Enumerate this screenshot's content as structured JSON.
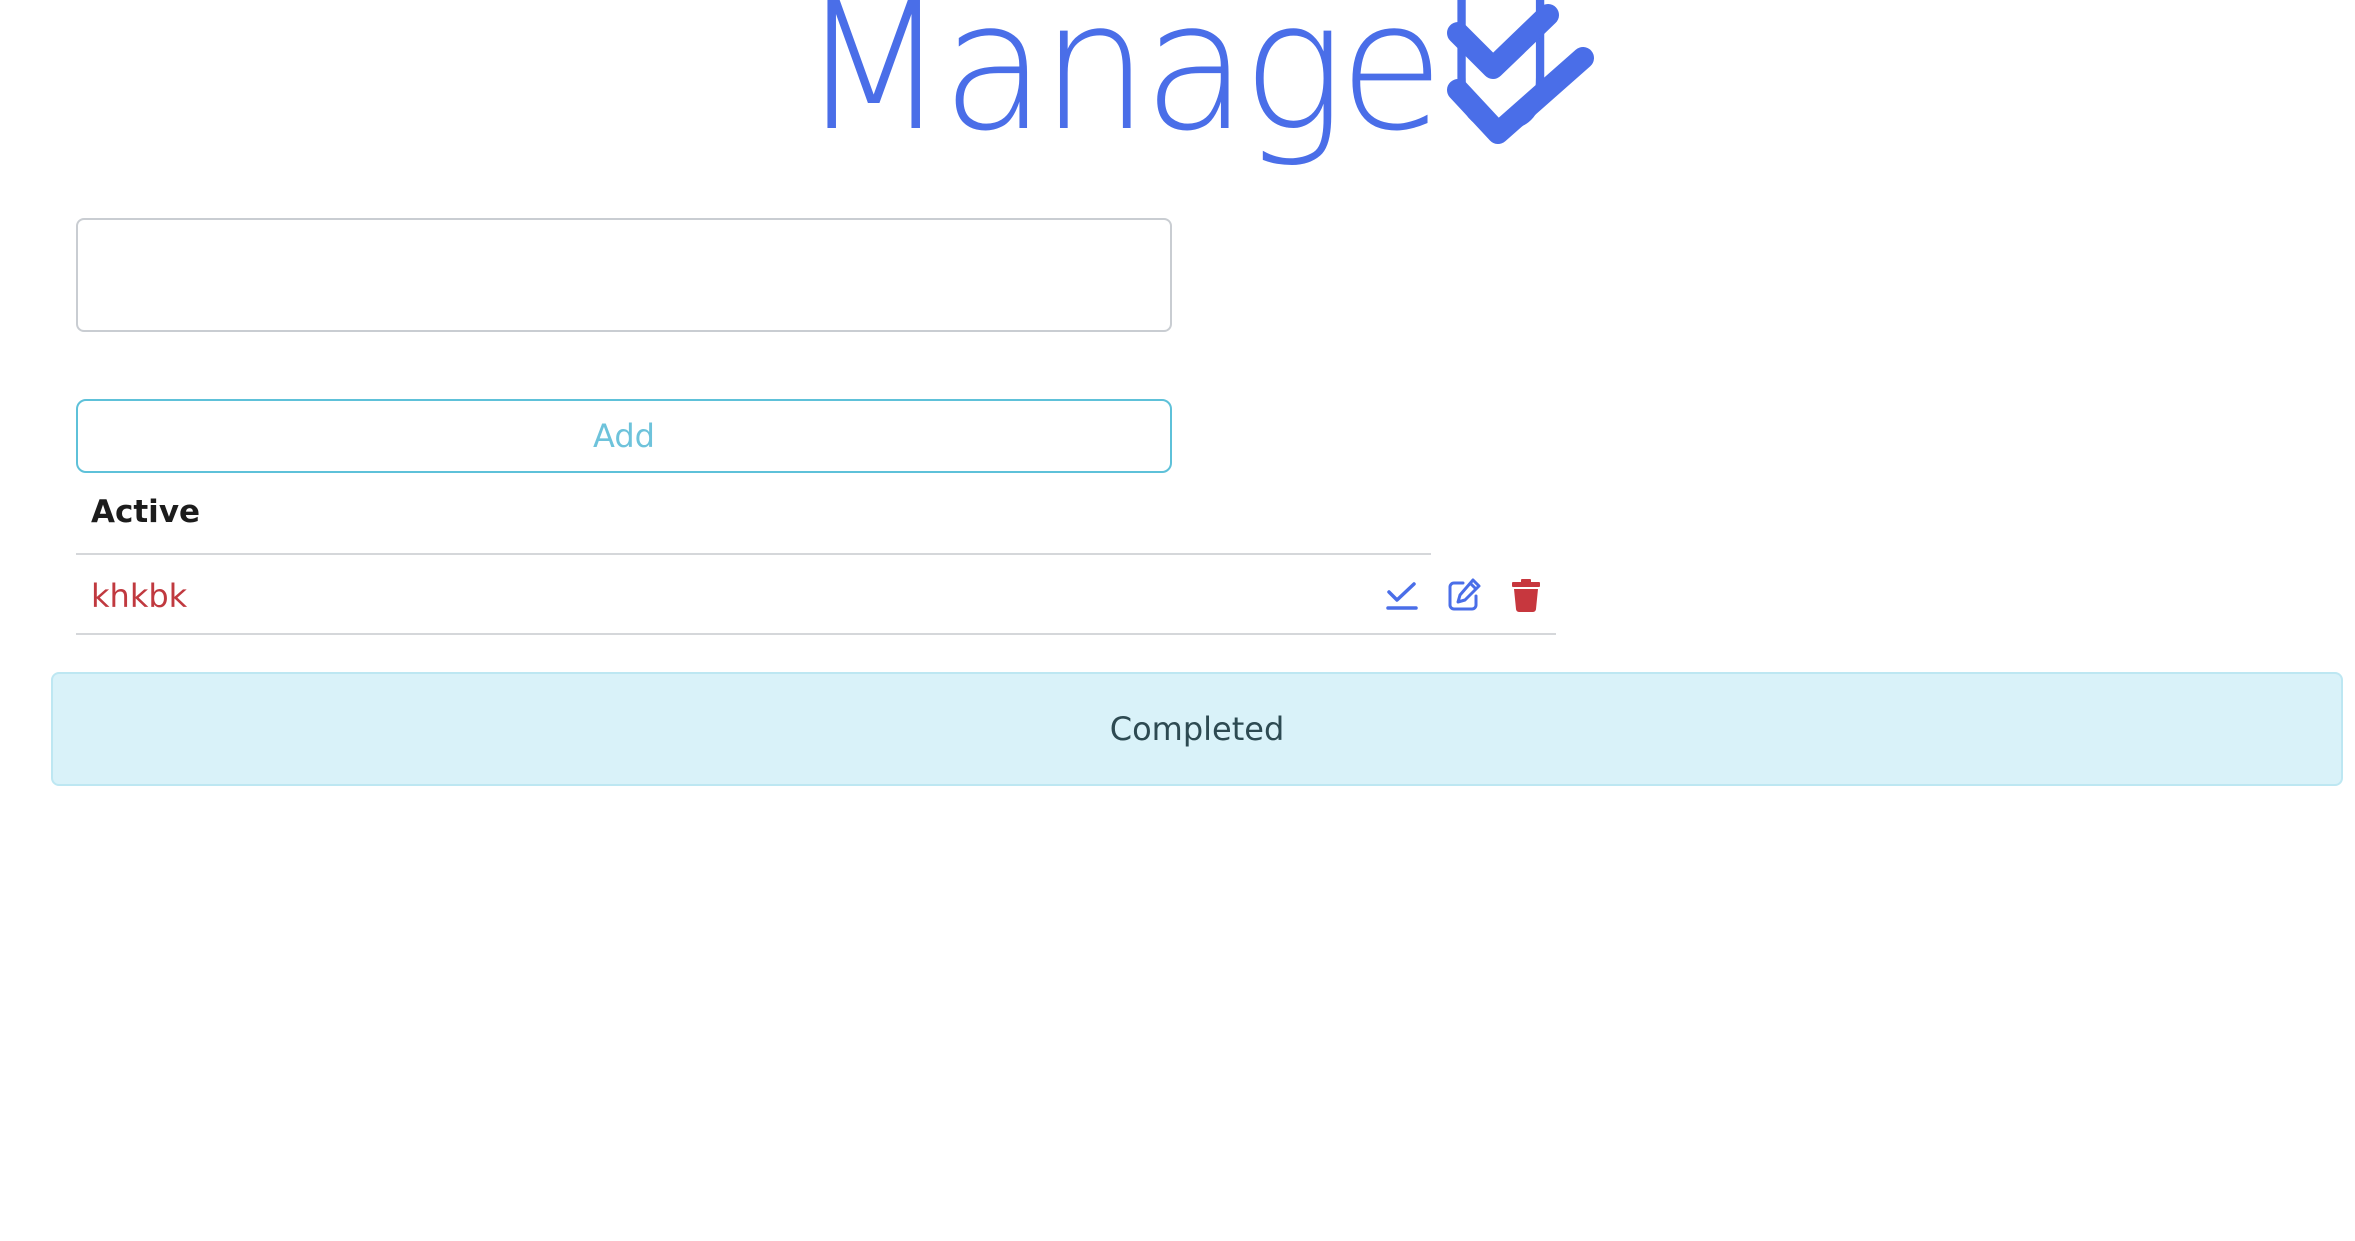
{
  "app": {
    "logo_text": "ManageU"
  },
  "form": {
    "task_input_value": "",
    "task_input_placeholder": "",
    "add_label": "Add"
  },
  "active": {
    "heading": "Active",
    "tasks": [
      {
        "text": "khkbk"
      }
    ]
  },
  "completed": {
    "label": "Completed"
  },
  "icons": {
    "logo": "double-check-icon",
    "complete": "check-icon",
    "edit": "edit-icon",
    "delete": "trash-icon"
  },
  "colors": {
    "brand": "#4a6ee8",
    "task_text": "#c0393f",
    "delete": "#c7373e",
    "add_button": "#5ec1d9",
    "completed_bg": "#d9f2f9"
  }
}
